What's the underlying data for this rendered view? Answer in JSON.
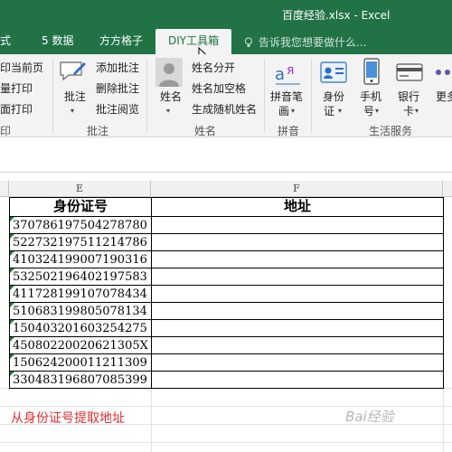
{
  "window": {
    "title": "百度经验.xlsx - Excel"
  },
  "tabs": [
    "式",
    "5 数据",
    "方方格子",
    "DIY工具箱"
  ],
  "tell_me": "告诉我您想要做什么...",
  "ribbon": {
    "left_partial": [
      "印当前页",
      "量打印",
      "面打印"
    ],
    "group_print_label": "印",
    "comment": {
      "big_label": "批注",
      "items": [
        "添加批注",
        "删除批注",
        "批注阅览"
      ],
      "group_label": "批注"
    },
    "name": {
      "big_label": "姓名",
      "items": [
        "姓名分开",
        "姓名加空格",
        "生成随机姓名"
      ],
      "group_label": "姓名"
    },
    "pinyin": {
      "big_label_1": "拼音笔",
      "big_label_2": "画",
      "group_label": "拼音"
    },
    "life": {
      "buttons": [
        {
          "l1": "身份",
          "l2": "证"
        },
        {
          "l1": "手机",
          "l2": "号"
        },
        {
          "l1": "银行",
          "l2": "卡"
        },
        {
          "l1": "更多",
          "l2": ""
        }
      ],
      "group_label": "生活服务"
    }
  },
  "columns": {
    "e": "E",
    "f": "F"
  },
  "sheet": {
    "header_e": "身份证号",
    "header_f": "地址",
    "ids": [
      "370786197504278780",
      "522732197511214786",
      "410324199007190316",
      "532502196402197583",
      "411728199107078434",
      "510683199805078134",
      "150403201603254275",
      "45080220020621305X",
      "150624200011211309",
      "330483196807085399"
    ]
  },
  "note": "从身份证号提取地址",
  "watermark": "Bai经验"
}
